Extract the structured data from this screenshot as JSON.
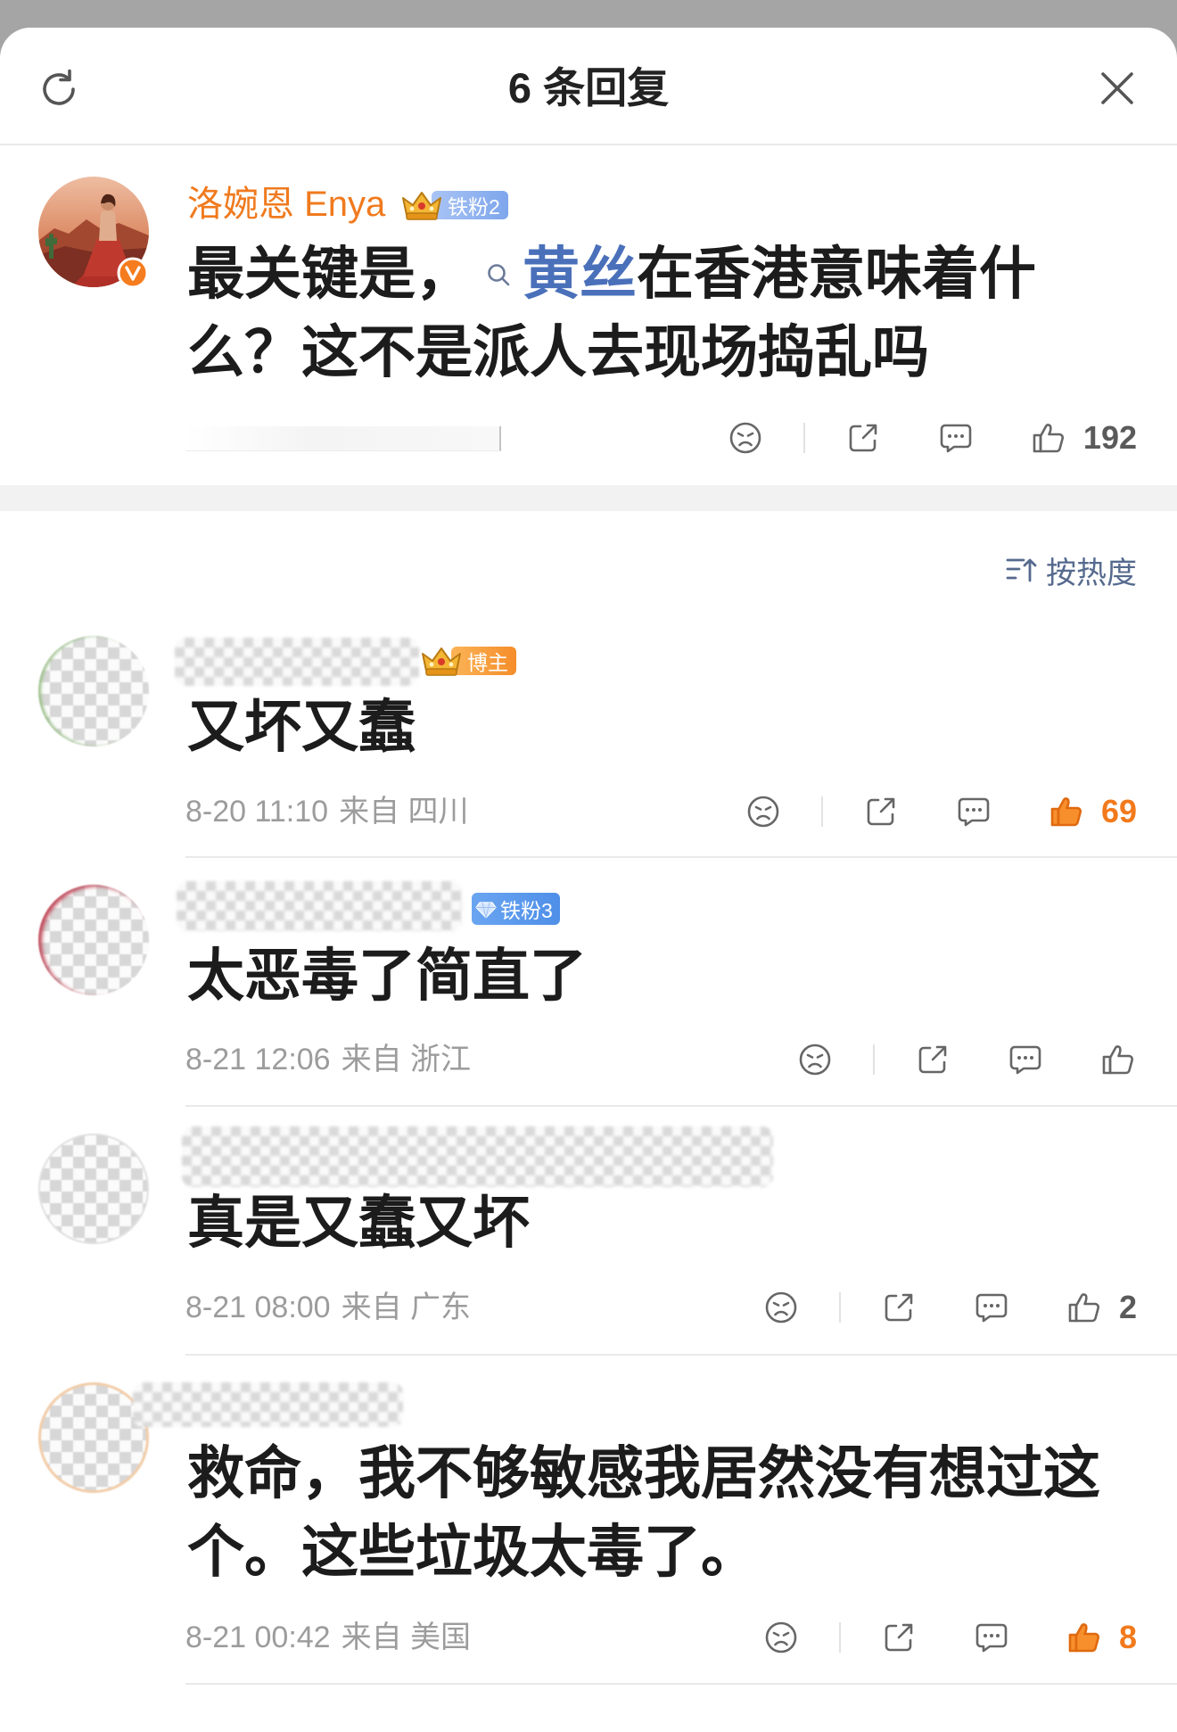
{
  "header": {
    "title": "6 条回复",
    "refresh_icon": "refresh-icon",
    "close_icon": "close-icon"
  },
  "main_comment": {
    "username": "洛婉恩 Enya",
    "verified_icon": "verified-v-icon",
    "badge_icon": "crown-icon",
    "badge_label": "铁粉2",
    "text_before": "最关键是，",
    "topic_icon": "search-icon",
    "topic": "黄丝",
    "text_after": "在香港意味着什么？这不是派人去现场捣乱吗",
    "like_count": "192",
    "liked": false
  },
  "sort": {
    "icon": "sort-icon",
    "label": "按热度"
  },
  "replies": [
    {
      "badge_icon": "crown-icon",
      "badge_label": "博主",
      "text": "又坏又蠢",
      "time": "8-20 11:10",
      "location": "来自 四川",
      "like_count": "69",
      "liked": true
    },
    {
      "badge_icon": "diamond-icon",
      "badge_label": "铁粉3",
      "text": "太恶毒了简直了",
      "time": "8-21 12:06",
      "location": "来自 浙江",
      "liked": false
    },
    {
      "text": "真是又蠢又坏",
      "time": "8-21 08:00",
      "location": "来自 广东",
      "like_count": "2",
      "liked": false
    },
    {
      "text": "救命，我不够敏感我居然没有想过这个。这些垃圾太毒了。",
      "time": "8-21 00:42",
      "location": "来自 美国",
      "like_count": "8",
      "liked": true
    }
  ],
  "action_icons": [
    "dislike-face-icon",
    "share-icon",
    "comment-icon",
    "thumbs-up-icon"
  ],
  "colors": {
    "username_orange": "#f07a1e",
    "liked_orange": "#f7902c",
    "topic_blue": "#4a70ba",
    "sort_label": "#566a8e",
    "meta_gray": "#9c9c9c",
    "overlay_gray": "#a5a5a5"
  }
}
